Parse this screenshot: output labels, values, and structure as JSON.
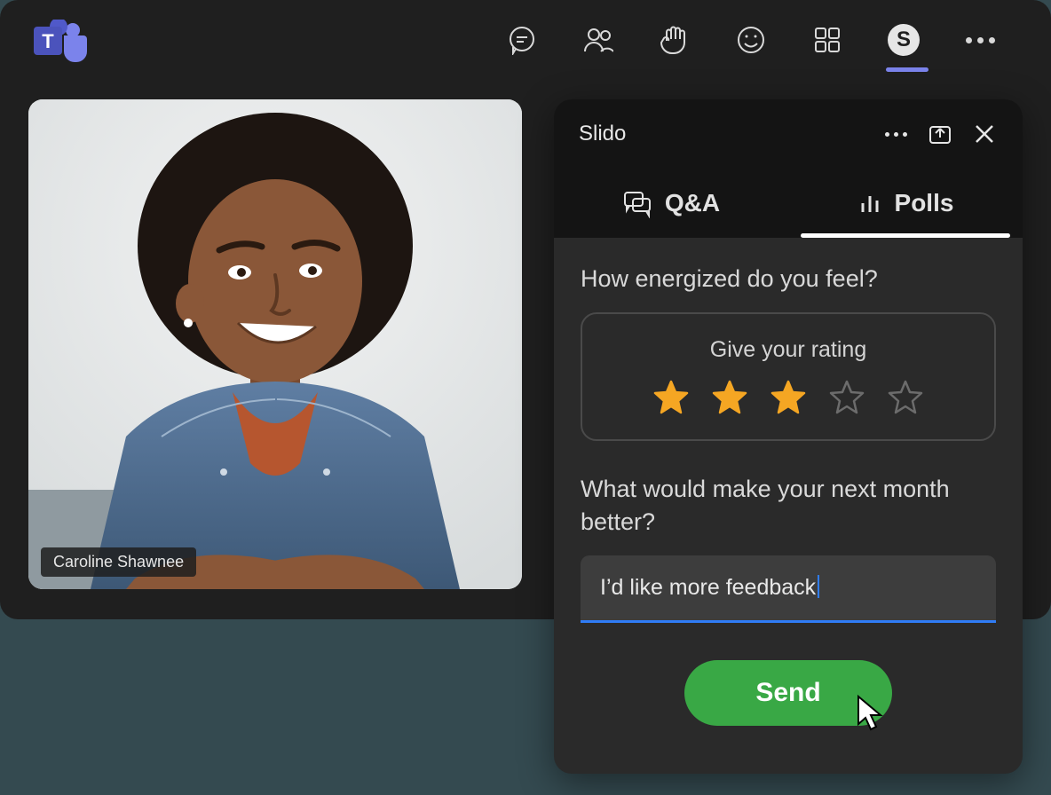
{
  "topbar": {
    "icons": [
      "chat-icon",
      "people-icon",
      "raise-hand-icon",
      "reactions-icon",
      "rooms-icon",
      "slido-app-icon",
      "more-icon"
    ],
    "slido_letter": "S"
  },
  "video": {
    "participant_name": "Caroline Shawnee"
  },
  "panel": {
    "title": "Slido",
    "header_icons": [
      "panel-more-icon",
      "popout-icon",
      "close-icon"
    ],
    "tabs": {
      "qa": "Q&A",
      "polls": "Polls",
      "active": "polls"
    },
    "poll1": {
      "question": "How energized do you feel?",
      "rating_label": "Give your rating",
      "max": 5,
      "value": 3
    },
    "poll2": {
      "question": "What would make your next month better?",
      "input_value": "I’d like more feedback"
    },
    "send_label": "Send"
  },
  "colors": {
    "accent_purple": "#7b83eb",
    "focus_blue": "#2f7cf6",
    "send_green": "#39a845",
    "star_filled": "#f5a623",
    "star_empty": "#6c6c6c"
  }
}
